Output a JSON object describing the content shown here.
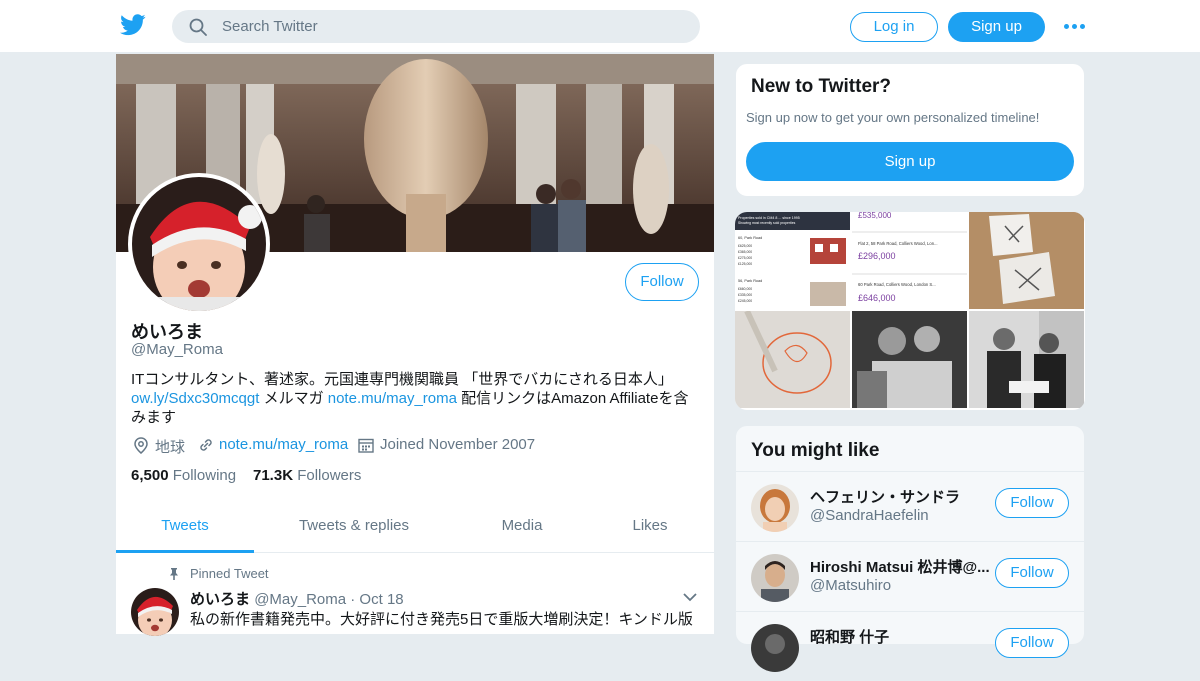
{
  "header": {
    "search_placeholder": "Search Twitter",
    "login_label": "Log in",
    "signup_label": "Sign up",
    "brand_color": "#1da1f2"
  },
  "profile": {
    "name": "めいろま",
    "handle": "@May_Roma",
    "follow_label": "Follow",
    "bio_line1": "ITコンサルタント、著述家。元国連専門機関職員 「世界でバカにされる日本人」",
    "bio_link1": "ow.ly/Sdxc30mcqgt",
    "bio_mid": " メルマガ ",
    "bio_link2": "note.mu/may_roma",
    "bio_tail": " 配信リンクはAmazon Affiliateを含",
    "bio_line3": "みます",
    "location": "地球",
    "website": "note.mu/may_roma",
    "joined": "Joined November 2007",
    "following_count": "6,500",
    "following_label": "Following",
    "followers_count": "71.3K",
    "followers_label": "Followers"
  },
  "tabs": [
    {
      "label": "Tweets",
      "active": true
    },
    {
      "label": "Tweets & replies",
      "active": false
    },
    {
      "label": "Media",
      "active": false
    },
    {
      "label": "Likes",
      "active": false
    }
  ],
  "pinned_tweet": {
    "pinned_label": "Pinned Tweet",
    "author": "めいろま",
    "meta": "@May_Roma · Oct 18",
    "text": "私の新作書籍発売中。大好評に付き発売5日で重版大増刷決定！キンドル版"
  },
  "sidebar": {
    "new_title": "New to Twitter?",
    "new_desc": "Sign up now to get your own personalized timeline!",
    "new_signup": "Sign up",
    "media_thumbs": [
      {
        "lines": [
          "Properties sold in CM4 8 ... since 1995",
          "Showing most recently sold properties",
          "60, Park Road",
          "£625,000",
          "£365,000",
          "£275,000",
          "£125,000",
          "56, Park Road",
          "£660,000",
          "£335,000",
          "£245,000"
        ]
      },
      {
        "lines": [
          "£535,000",
          "Flat 2, 58 Park Road, Colliers Wood, Lon...",
          "£296,000",
          "60 Park Road, Colliers Wood, London S...",
          "£646,000"
        ]
      }
    ],
    "might_title": "You might like",
    "suggestions": [
      {
        "name": "ヘフェリン・サンドラ",
        "handle": "@SandraHaefelin",
        "follow": "Follow"
      },
      {
        "name": "Hiroshi Matsui 松井博@...",
        "handle": "@Matsuhiro",
        "follow": "Follow"
      },
      {
        "name": "昭和野 什子",
        "handle": "",
        "follow": "Follow"
      }
    ]
  }
}
